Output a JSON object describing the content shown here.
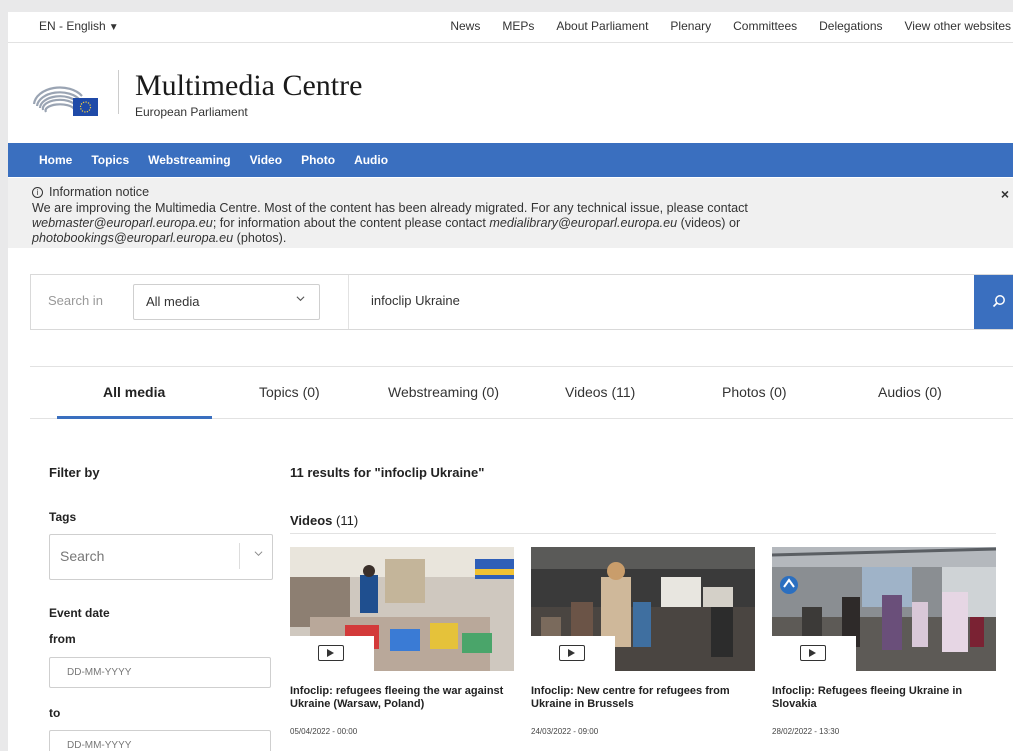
{
  "utility": {
    "language": "EN - English",
    "links": [
      "News",
      "MEPs",
      "About Parliament",
      "Plenary",
      "Committees",
      "Delegations",
      "View other websites"
    ]
  },
  "header": {
    "title": "Multimedia Centre",
    "subtitle": "European Parliament"
  },
  "nav": {
    "items": [
      "Home",
      "Topics",
      "Webstreaming",
      "Video",
      "Photo",
      "Audio"
    ]
  },
  "notice": {
    "title": "Information notice",
    "line1": "We are improving the Multimedia Centre. Most of the content has been already migrated. For any technical issue, please contact",
    "email1": "webmaster@europarl.europa.eu",
    "line2a": "; for information about the content please contact ",
    "email2": "medialibrary@europarl.europa.eu",
    "line2b": " (videos) or",
    "email3": "photobookings@europarl.europa.eu",
    "line3": " (photos).",
    "close": "×"
  },
  "search": {
    "label": "Search in",
    "scope": "All media",
    "query": "infoclip Ukraine"
  },
  "tabs": [
    "All media",
    "Topics (0)",
    "Webstreaming (0)",
    "Videos (11)",
    "Photos (0)",
    "Audios (0)"
  ],
  "filter": {
    "title": "Filter by",
    "tags_label": "Tags",
    "tags_placeholder": "Search",
    "event_label": "Event date",
    "from_label": "from",
    "from_placeholder": "DD-MM-YYYY",
    "to_label": "to",
    "to_placeholder": "DD-MM-YYYY"
  },
  "results": {
    "summary": "11 results for \"infoclip Ukraine\"",
    "section_label": "Videos",
    "section_count": "(11)",
    "items": [
      {
        "title": "Infoclip: refugees fleeing the war against Ukraine (Warsaw, Poland)",
        "date": "05/04/2022 - 00:00"
      },
      {
        "title": "Infoclip: New centre for refugees from Ukraine in Brussels",
        "date": "24/03/2022 - 09:00"
      },
      {
        "title": "Infoclip: Refugees fleeing Ukraine in Slovakia",
        "date": "28/02/2022 - 13:30"
      }
    ]
  },
  "colors": {
    "brand_blue": "#3a6fbf",
    "notice_bg": "#f0f0f0"
  }
}
